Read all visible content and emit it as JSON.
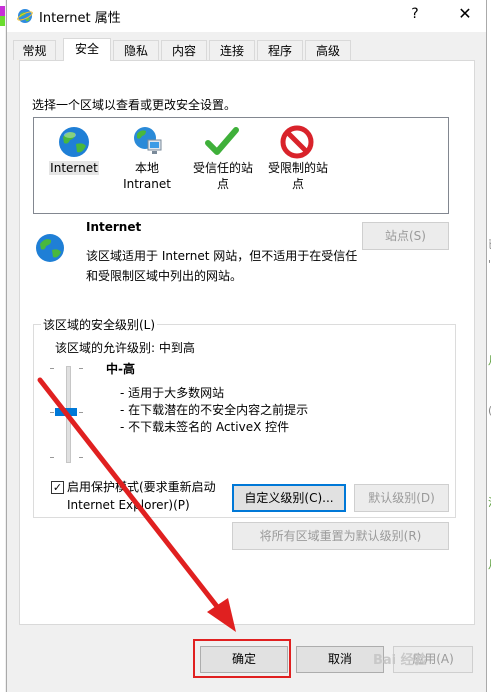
{
  "window": {
    "title": "Internet 属性",
    "help": "?",
    "close": "✕"
  },
  "tabs": [
    {
      "label": "常规"
    },
    {
      "label": "安全",
      "active": true
    },
    {
      "label": "隐私"
    },
    {
      "label": "内容"
    },
    {
      "label": "连接"
    },
    {
      "label": "程序"
    },
    {
      "label": "高级"
    }
  ],
  "security": {
    "prompt": "选择一个区域以查看或更改安全设置。",
    "zones": [
      {
        "name": "Internet",
        "icon": "globe-icon"
      },
      {
        "name": "本地",
        "name2": "Intranet",
        "icon": "local-intranet-icon"
      },
      {
        "name": "受信任的站",
        "name2": "点",
        "icon": "green-check-icon"
      },
      {
        "name": "受限制的站",
        "name2": "点",
        "icon": "restricted-icon"
      }
    ],
    "selected_zone": {
      "name": "Internet",
      "description": "该区域适用于 Internet 网站，但不适用于在受信任和受限制区域中列出的网站。"
    },
    "sites_button": "站点(S)",
    "level_group_label": "该区域的安全级别(L)",
    "allowed_levels": "该区域的允许级别: 中到高",
    "level_name": "中-高",
    "level_bullets": [
      "- 适用于大多数网站",
      "- 在下载潜在的不安全内容之前提示",
      "- 不下载未签名的 ActiveX 控件"
    ],
    "protected_mode": {
      "checked": true,
      "line1": "启用保护模式(要求重新启动",
      "line2": "Internet Explorer)(P)"
    },
    "custom_level_button": "自定义级别(C)...",
    "default_level_button": "默认级别(D)",
    "reset_all_button": "将所有区域重置为默认级别(R)"
  },
  "footer": {
    "ok": "确定",
    "cancel": "取消",
    "apply": "应用(A)"
  },
  "watermark": "Bai 经验",
  "colors": {
    "accent": "#0078d7",
    "annotation": "#e02020"
  }
}
